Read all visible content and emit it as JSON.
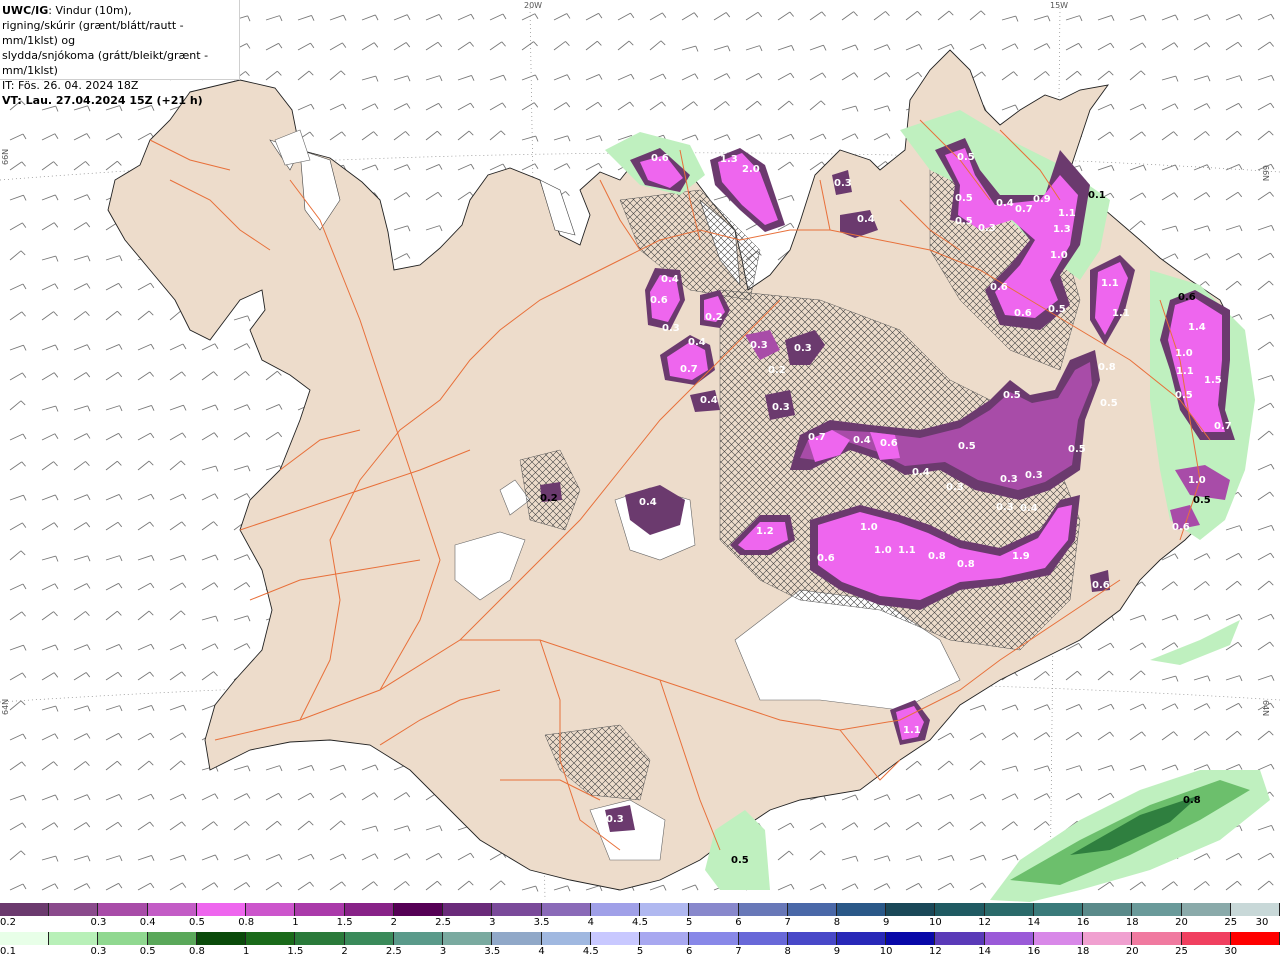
{
  "header": {
    "title_bold": "UWC/IG",
    "title_rest": ": Vindur (10m),",
    "line2": "rigning/skúrir (grænt/blátt/rautt - mm/1klst) og",
    "line3": "slydda/snjókoma (grátt/bleikt/grænt - mm/1klst)",
    "it": "IT: Fös. 26. 04. 2024 18Z",
    "vt": "VT: Lau. 27.04.2024 15Z (+21 h)"
  },
  "grid_labels": {
    "lon_20w": "20W",
    "lon_15w": "15W",
    "lat_66n_left": "66N",
    "lat_66n_right": "66N",
    "lat_64n_left": "64N",
    "lat_64n_right": "64N"
  },
  "colors": {
    "land": "#eddccb",
    "sea": "#ffffff",
    "roads": "#e8703a",
    "snow_dark": "#6b3a6e",
    "snow_mid": "#a84ca8",
    "snow_light": "#ee66ee",
    "rain_light": "#bff0bf",
    "rain_mid": "#6cbf6c",
    "rain_dark": "#2f7f3f"
  },
  "precip_labels": [
    {
      "id": "a1",
      "text": "1.3"
    },
    {
      "id": "a2",
      "text": "2.0"
    },
    {
      "id": "a3",
      "text": "0.3"
    },
    {
      "id": "a4",
      "text": "0.4"
    },
    {
      "id": "a5",
      "text": "0.6"
    },
    {
      "id": "a6",
      "text": "0.3"
    },
    {
      "id": "a7",
      "text": "0.2"
    },
    {
      "id": "a8",
      "text": "0.4"
    },
    {
      "id": "a9",
      "text": "0.7"
    },
    {
      "id": "a10",
      "text": "0.4"
    },
    {
      "id": "a11",
      "text": "0.3"
    },
    {
      "id": "a12",
      "text": "0.3"
    },
    {
      "id": "a13",
      "text": "0.2"
    },
    {
      "id": "a14",
      "text": "0.3"
    },
    {
      "id": "a15",
      "text": "0.7"
    },
    {
      "id": "a16",
      "text": "0.4"
    },
    {
      "id": "a17",
      "text": "0.6"
    },
    {
      "id": "a18",
      "text": "0.4"
    },
    {
      "id": "a19",
      "text": "0.5"
    },
    {
      "id": "a20",
      "text": "0.3"
    },
    {
      "id": "a21",
      "text": "0.2"
    },
    {
      "id": "a22",
      "text": "0.4"
    },
    {
      "id": "a23",
      "text": "1.2"
    },
    {
      "id": "a24",
      "text": "1.0"
    },
    {
      "id": "a25",
      "text": "0.6"
    },
    {
      "id": "a26",
      "text": "1.0"
    },
    {
      "id": "a27",
      "text": "1.1"
    },
    {
      "id": "a28",
      "text": "0.8"
    },
    {
      "id": "a29",
      "text": "0.8"
    },
    {
      "id": "a30",
      "text": "1.9"
    },
    {
      "id": "a31",
      "text": "0.3"
    },
    {
      "id": "a32",
      "text": "0.4"
    },
    {
      "id": "a33",
      "text": "0.5"
    },
    {
      "id": "a34",
      "text": "0.5"
    },
    {
      "id": "a35",
      "text": "0.5"
    },
    {
      "id": "a36",
      "text": "0.8"
    },
    {
      "id": "a37",
      "text": "0.3"
    },
    {
      "id": "a38",
      "text": "0.5"
    },
    {
      "id": "a39",
      "text": "0.6"
    },
    {
      "id": "a40",
      "text": "0.6"
    },
    {
      "id": "a41",
      "text": "1.0"
    },
    {
      "id": "a42",
      "text": "1.3"
    },
    {
      "id": "a43",
      "text": "1.1"
    },
    {
      "id": "a44",
      "text": "0.9"
    },
    {
      "id": "a45",
      "text": "0.7"
    },
    {
      "id": "a46",
      "text": "0.4"
    },
    {
      "id": "a47",
      "text": "0.3"
    },
    {
      "id": "a48",
      "text": "0.5"
    },
    {
      "id": "a49",
      "text": "0.5"
    },
    {
      "id": "a50",
      "text": "0.1"
    },
    {
      "id": "a51",
      "text": "1.1"
    },
    {
      "id": "a52",
      "text": "1.1"
    },
    {
      "id": "a53",
      "text": "0.6"
    },
    {
      "id": "a54",
      "text": "1.4"
    },
    {
      "id": "a55",
      "text": "1.0"
    },
    {
      "id": "a56",
      "text": "1.1"
    },
    {
      "id": "a57",
      "text": "1.5"
    },
    {
      "id": "a58",
      "text": "0.5"
    },
    {
      "id": "a59",
      "text": "0.7"
    },
    {
      "id": "a60",
      "text": "1.0"
    },
    {
      "id": "a61",
      "text": "0.5"
    },
    {
      "id": "a62",
      "text": "0.6"
    },
    {
      "id": "a63",
      "text": "0.6"
    },
    {
      "id": "a64",
      "text": "1.1"
    },
    {
      "id": "a65",
      "text": "0.3"
    },
    {
      "id": "a66",
      "text": "0.5"
    },
    {
      "id": "a67",
      "text": "0.8"
    },
    {
      "id": "a68",
      "text": "0.6"
    },
    {
      "id": "a69",
      "text": "0.5"
    },
    {
      "id": "a70",
      "text": "0.4"
    },
    {
      "id": "a71",
      "text": "0.3"
    }
  ],
  "scale_top": {
    "labels": [
      "0.2",
      "0.3",
      "0.4",
      "0.5",
      "0.8",
      "1",
      "1.5",
      "2",
      "2.5",
      "3",
      "3.5",
      "4",
      "4.5",
      "5",
      "6",
      "7",
      "8",
      "9",
      "10",
      "12",
      "14",
      "16",
      "18",
      "20",
      "25",
      "30"
    ],
    "colors": [
      "#6b3a6e",
      "#8a4a8c",
      "#a84ca8",
      "#c35cc6",
      "#ee66ee",
      "#cc55cc",
      "#aa3aaa",
      "#882288",
      "#550055",
      "#6a2a7a",
      "#7a4a9a",
      "#8a6ab8",
      "#a0a0e8",
      "#b0b8f0",
      "#8888cc",
      "#6878b8",
      "#4a68a8",
      "#2a5888",
      "#1a4858",
      "#1f5a62",
      "#2a6a6a",
      "#3a7a7a",
      "#5a8a8a",
      "#6a9a9a",
      "#8aaaaa",
      "#c8d8d8"
    ]
  },
  "scale_bottom": {
    "labels": [
      "0.1",
      "0.3",
      "0.5",
      "0.8",
      "1",
      "1.5",
      "2",
      "2.5",
      "3",
      "3.5",
      "4",
      "4.5",
      "5",
      "6",
      "7",
      "8",
      "9",
      "10",
      "12",
      "14",
      "16",
      "18",
      "20",
      "25",
      "30"
    ],
    "colors": [
      "#e8ffe8",
      "#b8f0b8",
      "#90d890",
      "#5aa85a",
      "#0a4a0a",
      "#1a6a1a",
      "#2a7a3a",
      "#3a8a5a",
      "#5a9a8a",
      "#7aaaa0",
      "#90a8c8",
      "#a0b8e0",
      "#c8c8ff",
      "#a8a8f0",
      "#8888e8",
      "#6868d8",
      "#4848c8",
      "#2828b8",
      "#0808a8",
      "#5a3ab8",
      "#9a5ad8",
      "#d888e8",
      "#f0a0d0",
      "#f07aa0",
      "#f04060",
      "#ff0000"
    ]
  }
}
